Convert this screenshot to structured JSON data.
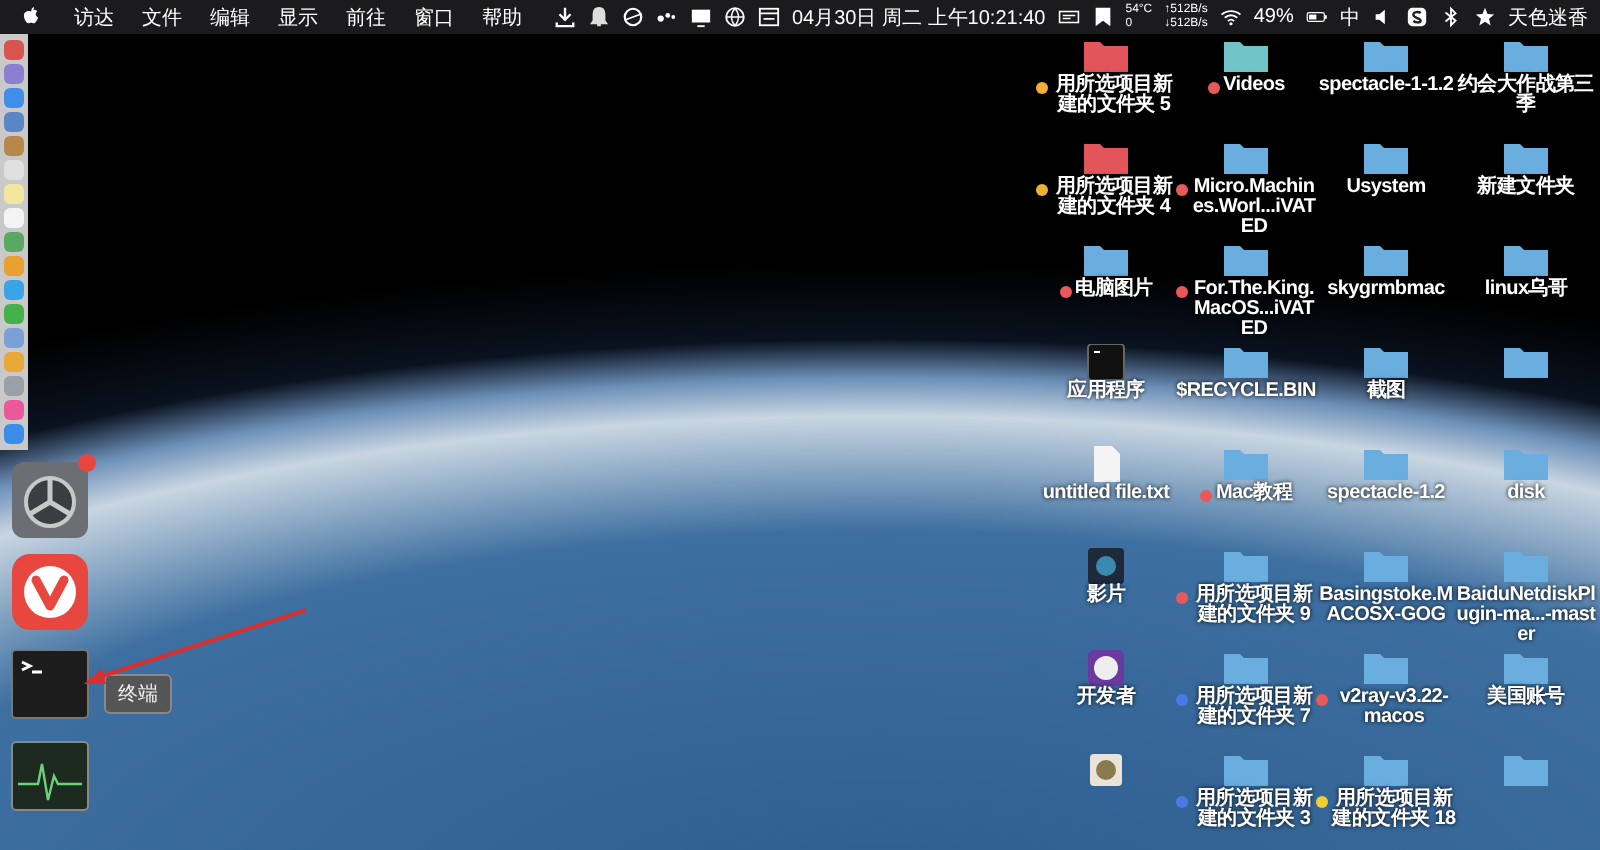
{
  "menu_bar": {
    "menus": [
      "访达",
      "文件",
      "编辑",
      "显示",
      "前往",
      "窗口",
      "帮助"
    ],
    "date_time": "04月30日 周二 上午10:21:40",
    "temperature": "54°C",
    "temperature_2": "0",
    "upload": "↑512B/s",
    "download": "↓512B/s",
    "battery": "49%",
    "input_method": "中",
    "user": "天色迷香"
  },
  "dock": {
    "items": [
      {
        "kind": "small",
        "color": "#d9534f"
      },
      {
        "kind": "small",
        "color": "#8a7fd0"
      },
      {
        "kind": "small",
        "color": "#3f8ee8"
      },
      {
        "kind": "small",
        "color": "#5a86c6"
      },
      {
        "kind": "small",
        "color": "#b8874a"
      },
      {
        "kind": "small",
        "color": "#e0e0e0"
      },
      {
        "kind": "small",
        "color": "#f3e7a0"
      },
      {
        "kind": "small",
        "color": "#f4f4f4"
      },
      {
        "kind": "small",
        "color": "#5aa864"
      },
      {
        "kind": "small",
        "color": "#e8a030"
      },
      {
        "kind": "small",
        "color": "#3ba4e8"
      },
      {
        "kind": "small",
        "color": "#46b04a"
      },
      {
        "kind": "small",
        "color": "#7aa0d8"
      },
      {
        "kind": "small",
        "color": "#e8a838"
      },
      {
        "kind": "small",
        "color": "#9aa0a8"
      },
      {
        "kind": "small",
        "color": "#ea5a9a"
      },
      {
        "kind": "small",
        "color": "#3a8ee8"
      },
      {
        "kind": "settings",
        "badge": true
      },
      {
        "kind": "browser"
      },
      {
        "kind": "terminal"
      },
      {
        "kind": "monitor"
      }
    ],
    "tooltip": "终端"
  },
  "desktop_items": [
    {
      "kind": "folder",
      "color": "#e2555b",
      "tag": {
        "color": "#f0b030"
      },
      "label": "用所选项目新建的文件夹 5"
    },
    {
      "kind": "folder",
      "color": "#6fc4c8",
      "tag": {
        "color": "#e85a5a"
      },
      "label": "Videos"
    },
    {
      "kind": "folder",
      "color": "#6aaee0",
      "label": "spectacle-1-1.2"
    },
    {
      "kind": "folder",
      "color": "#6aaee0",
      "label": "约会大作战第三季"
    },
    {
      "kind": "folder",
      "color": "#e2555b",
      "tag": {
        "color": "#f0b030"
      },
      "label": "用所选项目新建的文件夹 4"
    },
    {
      "kind": "folder",
      "color": "#6aaee0",
      "tag": {
        "color": "#e85a5a"
      },
      "label": "Micro.Machines.Worl...iVATED"
    },
    {
      "kind": "folder",
      "color": "#6aaee0",
      "label": "Usystem"
    },
    {
      "kind": "folder",
      "color": "#6aaee0",
      "label": "新建文件夹"
    },
    {
      "kind": "folder",
      "color": "#6aaee0",
      "tag": {
        "color": "#e85a5a"
      },
      "label": "电脑图片"
    },
    {
      "kind": "folder",
      "color": "#6aaee0",
      "tag": {
        "color": "#e85a5a"
      },
      "label": "For.The.King.MacOS...iVATED"
    },
    {
      "kind": "folder",
      "color": "#6aaee0",
      "label": "skygrmbmac"
    },
    {
      "kind": "folder",
      "color": "#6aaee0",
      "label": "linux乌哥"
    },
    {
      "kind": "app",
      "label": "应用程序"
    },
    {
      "kind": "folder",
      "color": "#6aaee0",
      "label": "$RECYCLE.BIN"
    },
    {
      "kind": "folder",
      "color": "#6aaee0",
      "label": "截图"
    },
    {
      "kind": "folder",
      "color": "#6aaee0"
    },
    {
      "kind": "document",
      "label": "untitled file.txt"
    },
    {
      "kind": "folder",
      "color": "#6aaee0",
      "tag": {
        "color": "#e85a5a"
      },
      "label": "Mac教程"
    },
    {
      "kind": "folder",
      "color": "#6aaee0",
      "label": "spectacle-1.2"
    },
    {
      "kind": "folder",
      "color": "#6aaee0",
      "label": "disk"
    },
    {
      "kind": "image",
      "label": "影片"
    },
    {
      "kind": "folder",
      "color": "#6aaee0",
      "tag": {
        "color": "#e85a5a"
      },
      "label": "用所选项目新建的文件夹 9"
    },
    {
      "kind": "folder",
      "color": "#6aaee0",
      "label": "Basingstoke.MACOSX-GOG"
    },
    {
      "kind": "folder",
      "color": "#6aaee0",
      "label": "BaiduNetdiskPlugin-ma...-master"
    },
    {
      "kind": "developer",
      "label": "开发者"
    },
    {
      "kind": "folder",
      "color": "#6aaee0",
      "tag": {
        "color": "#4a7ae8"
      },
      "label": "用所选项目新建的文件夹 7"
    },
    {
      "kind": "folder",
      "color": "#6aaee0",
      "tag": {
        "color": "#e85a5a"
      },
      "label": "v2ray-v3.22-macos"
    },
    {
      "kind": "folder",
      "color": "#6aaee0",
      "label": "美国账号"
    },
    {
      "kind": "disk"
    },
    {
      "kind": "folder",
      "color": "#6aaee0",
      "tag": {
        "color": "#4a7ae8"
      },
      "label": "用所选项目新建的文件夹 3"
    },
    {
      "kind": "folder",
      "color": "#6aaee0",
      "tag": {
        "color": "#f0d030"
      },
      "label": "用所选项目新建的文件夹 18"
    },
    {
      "kind": "folder",
      "color": "#6aaee0"
    }
  ]
}
